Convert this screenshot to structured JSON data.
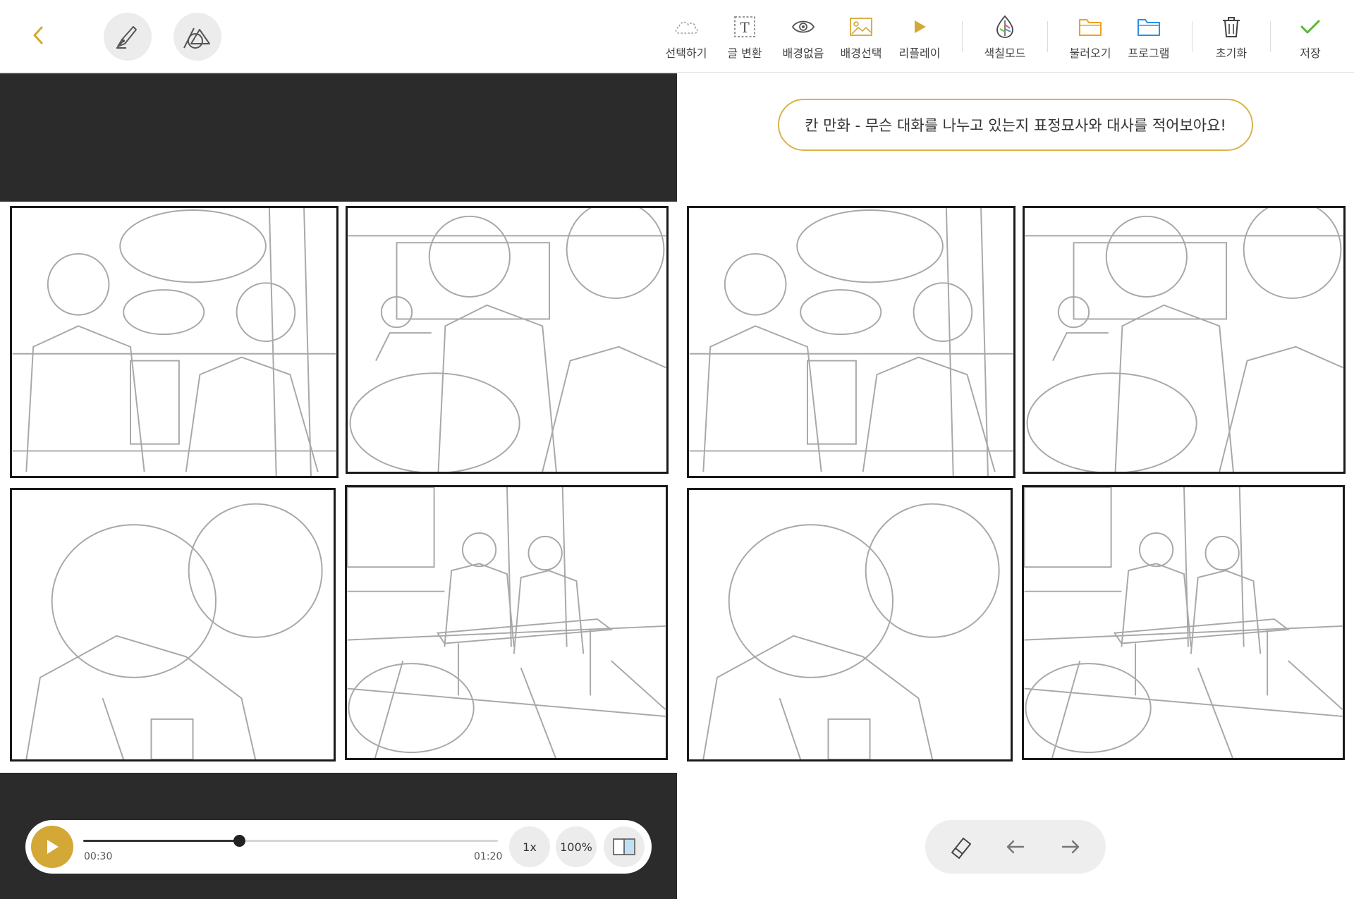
{
  "toolbar": {
    "back_icon": "chevron-left-icon",
    "pen_tool_icon": "pen-nib-icon",
    "shape_tool_icon": "shapes-icon",
    "items": [
      {
        "id": "select",
        "label": "선택하기",
        "icon": "cloud-outline-icon"
      },
      {
        "id": "text",
        "label": "글 변환",
        "icon": "text-box-icon"
      },
      {
        "id": "no-bg",
        "label": "배경없음",
        "icon": "eye-icon"
      },
      {
        "id": "bg-select",
        "label": "배경선택",
        "icon": "image-icon"
      },
      {
        "id": "replay",
        "label": "리플레이",
        "icon": "play-triangle-icon"
      },
      {
        "id": "color-mode",
        "label": "색칠모드",
        "icon": "color-drop-icon"
      },
      {
        "id": "load",
        "label": "불러오기",
        "icon": "folder-orange-icon"
      },
      {
        "id": "program",
        "label": "프로그램",
        "icon": "folder-blue-icon"
      },
      {
        "id": "reset",
        "label": "초기화",
        "icon": "trash-icon"
      },
      {
        "id": "save",
        "label": "저장",
        "icon": "checkmark-icon"
      }
    ],
    "accent": "#d4a836",
    "blue": "#2b8fe0",
    "green": "#5bb43a"
  },
  "prompt": {
    "text": "칸 만화 - 무슨 대화를 나누고 있는지 표정묘사와 대사를 적어보아요!"
  },
  "player": {
    "current_time": "00:30",
    "total_time": "01:20",
    "progress": 0.375,
    "speed_label": "1x",
    "zoom_label": "100%",
    "play_icon": "play-icon",
    "layout_icon": "split-view-icon"
  },
  "right_controls": {
    "eraser_icon": "eraser-icon",
    "undo_icon": "arrow-left-icon",
    "redo_icon": "arrow-right-icon"
  }
}
